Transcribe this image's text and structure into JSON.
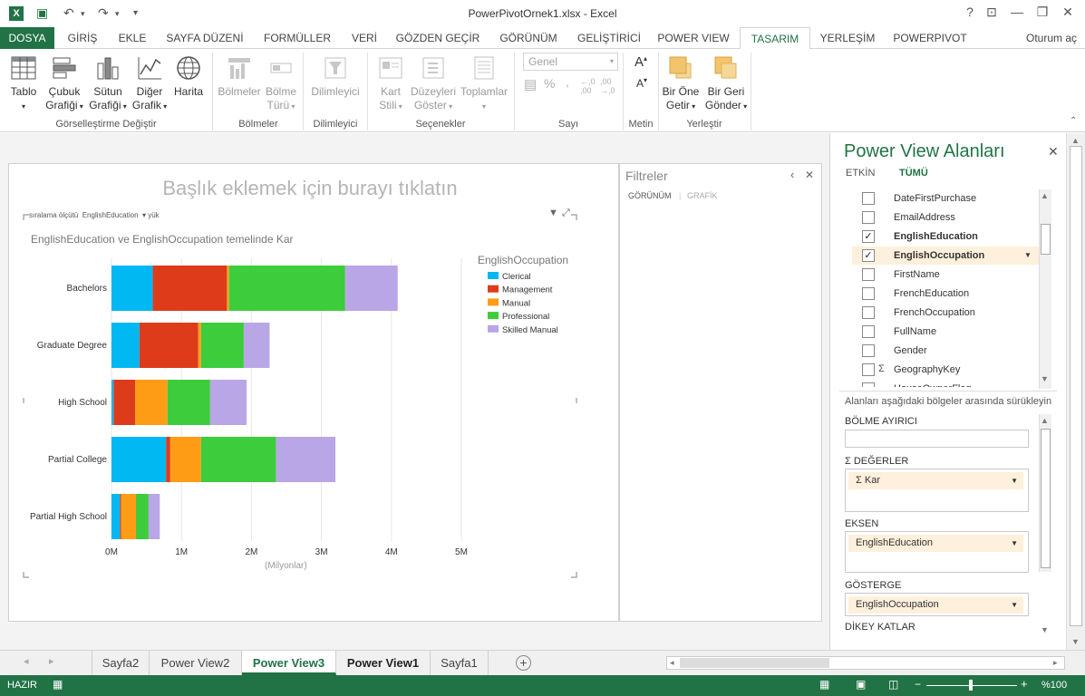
{
  "window": {
    "title": "PowerPivotOrnek1.xlsx - Excel",
    "help": "?",
    "minimize": "—",
    "restore": "❐",
    "close": "✕",
    "signin": "Oturum aç"
  },
  "tabs": [
    "DOSYA",
    "GİRİŞ",
    "EKLE",
    "SAYFA DÜZENİ",
    "FORMÜLLER",
    "VERİ",
    "GÖZDEN GEÇİR",
    "GÖRÜNÜM",
    "GELİŞTİRİCİ",
    "POWER VIEW",
    "TASARIM",
    "YERLEŞİM",
    "POWERPIVOT"
  ],
  "ribbon": {
    "groups": {
      "switch": "Görselleştirme Değiştir",
      "tiles": "Bölmeler",
      "slicer": "Dilimleyici",
      "options": "Seçenekler",
      "number": "Sayı",
      "text": "Metin",
      "arrange": "Yerleştir"
    },
    "buttons": {
      "table": "Tablo",
      "bar1": "Çubuk",
      "bar2": "Grafiği",
      "col1": "Sütun",
      "col2": "Grafiği",
      "other1": "Diğer",
      "other2": "Grafik",
      "map": "Harita",
      "tiles": "Bölmeler",
      "tiletype1": "Bölme",
      "tiletype2": "Türü",
      "slicer": "Dilimleyici",
      "card1": "Kart",
      "card2": "Stili",
      "levels1": "Düzeyleri",
      "levels2": "Göster",
      "totals": "Toplamlar",
      "number_format": "Genel",
      "front1": "Bir Öne",
      "front2": "Getir",
      "back1": "Bir Geri",
      "back2": "Gönder"
    }
  },
  "canvas": {
    "title_placeholder": "Başlık eklemek için burayı tıklatın",
    "sort_label": "sıralama ölçütü",
    "sort_field": "EnglishEducation",
    "sort_dir": "yük",
    "chart_title": "EnglishEducation ve EnglishOccupation temelinde Kar",
    "x_unit": "(Milyonlar)"
  },
  "filters": {
    "title": "Filtreler",
    "tab_view": "GÖRÜNÜM",
    "tab_chart": "GRAFİK"
  },
  "fields": {
    "title": "Power View Alanları",
    "tab_active": "ETKİN",
    "tab_all": "TÜMÜ",
    "items": [
      {
        "name": "DateFirstPurchase",
        "checked": false,
        "sigma": false
      },
      {
        "name": "EmailAddress",
        "checked": false,
        "sigma": false
      },
      {
        "name": "EnglishEducation",
        "checked": true,
        "sigma": false
      },
      {
        "name": "EnglishOccupation",
        "checked": true,
        "sigma": false
      },
      {
        "name": "FirstName",
        "checked": false,
        "sigma": false
      },
      {
        "name": "FrenchEducation",
        "checked": false,
        "sigma": false
      },
      {
        "name": "FrenchOccupation",
        "checked": false,
        "sigma": false
      },
      {
        "name": "FullName",
        "checked": false,
        "sigma": false
      },
      {
        "name": "Gender",
        "checked": false,
        "sigma": false
      },
      {
        "name": "GeographyKey",
        "checked": false,
        "sigma": true
      },
      {
        "name": "HouseOwnerFlag",
        "checked": false,
        "sigma": false
      }
    ],
    "drag_hint": "Alanları aşağıdaki bölgeler arasında sürükleyin",
    "tile_by": "BÖLME AYIRICI",
    "values": "DEĞERLER",
    "values_field": "Kar",
    "axis": "EKSEN",
    "axis_field": "EnglishEducation",
    "legend": "GÖSTERGE",
    "legend_field": "EnglishOccupation",
    "vertical": "DİKEY KATLAR"
  },
  "sheets": [
    "Sayfa2",
    "Power View2",
    "Power View3",
    "Power View1",
    "Sayfa1"
  ],
  "active_sheet": "Power View3",
  "status": {
    "ready": "HAZIR",
    "zoom": "%100"
  },
  "colors": {
    "excel_green": "#217346",
    "Clerical": "#01B8F2",
    "Management": "#DE3B1B",
    "Manual": "#FF9C16",
    "Professional": "#3CCC3C",
    "Skilled Manual": "#B9A6E6"
  },
  "chart_data": {
    "type": "bar",
    "orientation": "horizontal",
    "stacked": true,
    "title": "EnglishEducation ve EnglishOccupation temelinde Kar",
    "xlabel": "(Milyonlar)",
    "legend_title": "EnglishOccupation",
    "categories": [
      "Bachelors",
      "Graduate Degree",
      "High School",
      "Partial College",
      "Partial High School"
    ],
    "series": [
      {
        "name": "Clerical",
        "values": [
          0.59,
          0.4,
          0.03,
          0.78,
          0.12
        ]
      },
      {
        "name": "Management",
        "values": [
          1.06,
          0.84,
          0.31,
          0.06,
          0.02
        ]
      },
      {
        "name": "Manual",
        "values": [
          0.03,
          0.04,
          0.46,
          0.44,
          0.21
        ]
      },
      {
        "name": "Professional",
        "values": [
          1.66,
          0.61,
          0.61,
          1.07,
          0.18
        ]
      },
      {
        "name": "Skilled Manual",
        "values": [
          0.75,
          0.37,
          0.52,
          0.85,
          0.16
        ]
      }
    ],
    "x_ticks": [
      "0M",
      "1M",
      "2M",
      "3M",
      "4M",
      "5M"
    ],
    "xlim": [
      0,
      5
    ],
    "grid": true,
    "legend_position": "right"
  }
}
